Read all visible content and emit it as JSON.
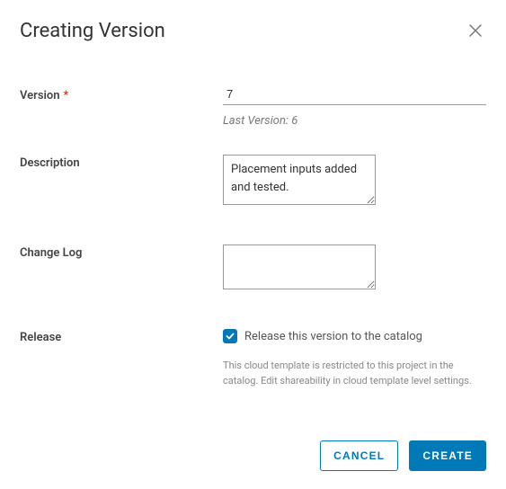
{
  "header": {
    "title": "Creating Version"
  },
  "form": {
    "version": {
      "label": "Version",
      "value": "7",
      "required": true,
      "last_version_text": "Last Version: 6"
    },
    "description": {
      "label": "Description",
      "value": "Placement inputs added and tested."
    },
    "changelog": {
      "label": "Change Log",
      "value": ""
    },
    "release": {
      "label": "Release",
      "checkbox_label": "Release this version to the catalog",
      "checked": true,
      "helper": "This cloud template is restricted to this project in the catalog. Edit shareability in cloud template level settings."
    }
  },
  "footer": {
    "cancel": "CANCEL",
    "create": "CREATE"
  }
}
